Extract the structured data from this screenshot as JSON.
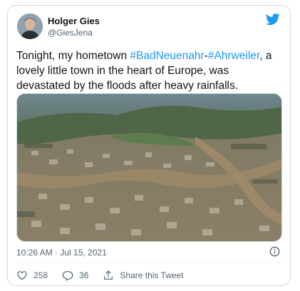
{
  "author": {
    "name": "Holger Gies",
    "handle": "@GiesJena"
  },
  "tweet": {
    "text_before": "Tonight, my hometown ",
    "hashtag_1": "#BadNeuenahr",
    "separator": "-",
    "hashtag_2": "#Ahrweiler",
    "text_after": ", a lovely little town in the heart of Europe, was devastated by the floods after heavy rainfalls."
  },
  "meta": {
    "timestamp": "10:26 AM · Jul 15, 2021"
  },
  "actions": {
    "likes": "258",
    "replies": "36",
    "share_label": "Share this Tweet"
  },
  "colors": {
    "accent": "#1d9bf0",
    "like": "#f91880"
  },
  "icons": [
    "twitter-bird-icon",
    "info-icon",
    "heart-icon",
    "reply-icon",
    "share-icon"
  ]
}
